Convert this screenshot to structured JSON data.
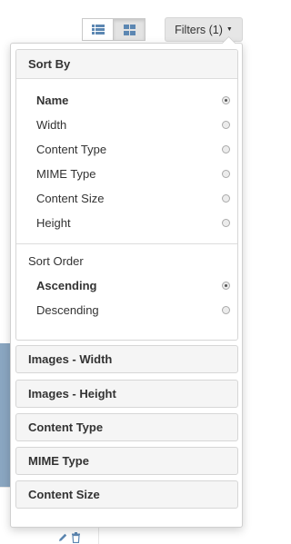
{
  "toolbar": {
    "filters_label": "Filters (1)"
  },
  "sort_by": {
    "title": "Sort By",
    "options": [
      {
        "label": "Name",
        "selected": true
      },
      {
        "label": "Width",
        "selected": false
      },
      {
        "label": "Content Type",
        "selected": false
      },
      {
        "label": "MIME Type",
        "selected": false
      },
      {
        "label": "Content Size",
        "selected": false
      },
      {
        "label": "Height",
        "selected": false
      }
    ]
  },
  "sort_order": {
    "title": "Sort Order",
    "options": [
      {
        "label": "Ascending",
        "selected": true
      },
      {
        "label": "Descending",
        "selected": false
      }
    ]
  },
  "filter_groups": [
    {
      "label": "Images - Width"
    },
    {
      "label": "Images - Height"
    },
    {
      "label": "Content Type"
    },
    {
      "label": "MIME Type"
    },
    {
      "label": "Content Size"
    }
  ],
  "icons": {
    "list_view": "list-icon",
    "grid_view": "grid-icon",
    "edit": "pencil-icon",
    "delete": "trash-icon"
  },
  "colors": {
    "accent": "#5c87b2",
    "thumbnail": "#8aa6c1"
  }
}
